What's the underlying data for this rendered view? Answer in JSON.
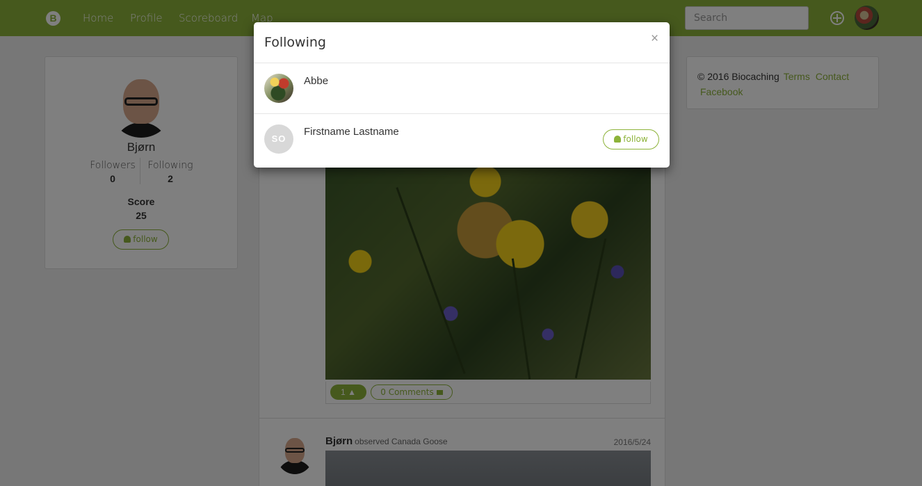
{
  "navbar": {
    "brand": "B",
    "links": [
      "Home",
      "Profile",
      "Scoreboard",
      "Map"
    ],
    "search_placeholder": "Search"
  },
  "profile": {
    "name": "Bjørn",
    "followers_label": "Followers",
    "followers_count": "0",
    "following_label": "Following",
    "following_count": "2",
    "score_label": "Score",
    "score_value": "25",
    "follow_label": "follow"
  },
  "footer": {
    "copyright": "© 2016 Biocaching",
    "links": [
      "Terms",
      "Contact",
      "Facebook"
    ]
  },
  "feed": {
    "like_count": "1",
    "comments_label": "0 Comments",
    "post": {
      "author": "Bjørn",
      "action": "observed Canada Goose",
      "date": "2016/5/24"
    }
  },
  "modal": {
    "title": "Following",
    "close": "×",
    "users": [
      {
        "name": "Abbe"
      },
      {
        "name": "Firstname Lastname",
        "initials": "SO",
        "follow_label": "follow"
      }
    ]
  },
  "colors": {
    "accent": "#8db33a"
  }
}
